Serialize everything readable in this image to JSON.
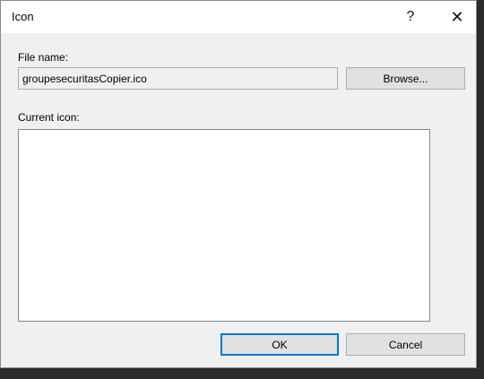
{
  "dialog": {
    "title": "Icon",
    "help_glyph": "?",
    "close_glyph": "✕"
  },
  "file_name": {
    "label": "File name:",
    "value": "groupesecuritasCopier.ico",
    "browse_label": "Browse..."
  },
  "current_icon": {
    "label": "Current icon:"
  },
  "footer": {
    "ok_label": "OK",
    "cancel_label": "Cancel"
  },
  "colors": {
    "focus_border": "#0078d7",
    "dialog_bg": "#f0f0f0",
    "button_bg": "#e1e1e1"
  }
}
